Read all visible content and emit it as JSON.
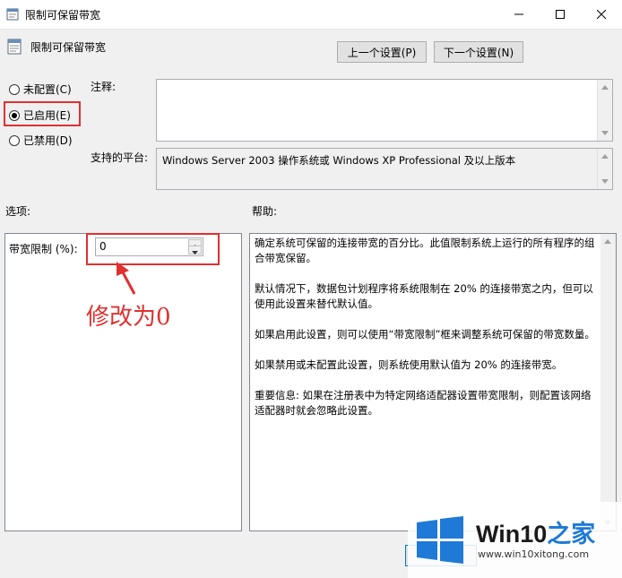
{
  "window": {
    "title": "限制可保留带宽"
  },
  "heading": {
    "title": "限制可保留带宽"
  },
  "nav": {
    "prev": "上一个设置(P)",
    "next": "下一个设置(N)"
  },
  "state": {
    "options": [
      {
        "label": "未配置(C)",
        "selected": false
      },
      {
        "label": "已启用(E)",
        "selected": true
      },
      {
        "label": "已禁用(D)",
        "selected": false
      }
    ]
  },
  "comment": {
    "label": "注释:",
    "value": ""
  },
  "platform": {
    "label": "支持的平台:",
    "value": "Windows Server 2003 操作系统或 Windows XP Professional 及以上版本"
  },
  "sections": {
    "options": "选项:",
    "help": "帮助:"
  },
  "bandwidth": {
    "label": "带宽限制 (%):",
    "value": "0"
  },
  "annotation": {
    "text": "修改为0"
  },
  "help": {
    "paragraphs": [
      "确定系统可保留的连接带宽的百分比。此值限制系统上运行的所有程序的组合带宽保留。",
      "默认情况下，数据包计划程序将系统限制在 20% 的连接带宽之内，但可以使用此设置来替代默认值。",
      "如果启用此设置，则可以使用“带宽限制”框来调整系统可保留的带宽数量。",
      "如果禁用或未配置此设置，则系统使用默认值为 20% 的连接带宽。",
      "重要信息: 如果在注册表中为特定网络适配器设置带宽限制，则配置该网络适配器时就会忽略此设置。"
    ]
  },
  "watermark": {
    "brand": "Win10",
    "brand_suffix": "之家",
    "url": "www.win10xitong.com"
  },
  "colors": {
    "accent": "#e03030",
    "win_blue": "#1e7ad6"
  }
}
